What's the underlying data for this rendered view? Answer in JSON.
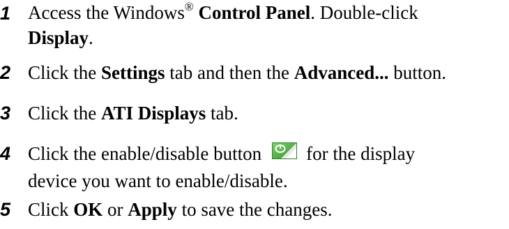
{
  "steps": [
    {
      "number": "1",
      "p1": "Access the Windows",
      "p2": "®",
      "p3": " ",
      "p4": "Control Panel",
      "p5": ". Double-click",
      "p6": "Display",
      "p7": "."
    },
    {
      "number": "2",
      "p1": "Click the ",
      "p2": "Settings",
      "p3": " tab and then the ",
      "p4": "Advanced...",
      "p5": " button."
    },
    {
      "number": "3",
      "p1": "Click the ",
      "p2": "ATI Displays",
      "p3": " tab."
    },
    {
      "number": "4",
      "p1": "Click the enable/disable button",
      "p2": "for the display",
      "p3": "device you want to enable/disable.",
      "icon": "enable-disable-toggle-icon",
      "icon_color": "#3aa531"
    },
    {
      "number": "5",
      "p1": "Click ",
      "p2": "OK",
      "p3": " or ",
      "p4": "Apply",
      "p5": " to save the changes."
    }
  ]
}
